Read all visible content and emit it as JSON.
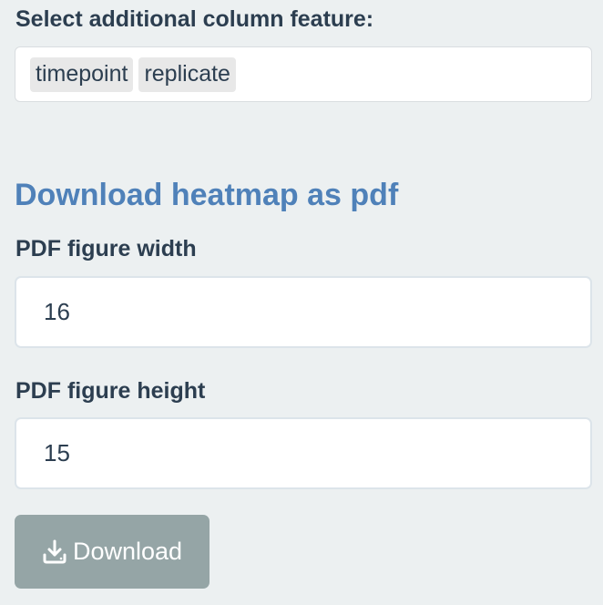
{
  "column_feature": {
    "label": "Select additional column feature:",
    "selected": [
      "timepoint",
      "replicate"
    ]
  },
  "download_section": {
    "heading": "Download heatmap as pdf",
    "width": {
      "label": "PDF figure width",
      "value": "16"
    },
    "height": {
      "label": "PDF figure height",
      "value": "15"
    },
    "button": {
      "label": "Download",
      "icon": "download-icon"
    }
  },
  "colors": {
    "background": "#ecf0f1",
    "text": "#2c3e50",
    "heading_accent": "#4f81b9",
    "button_bg": "#95a5a6",
    "chip_bg": "#e8e8e8"
  }
}
